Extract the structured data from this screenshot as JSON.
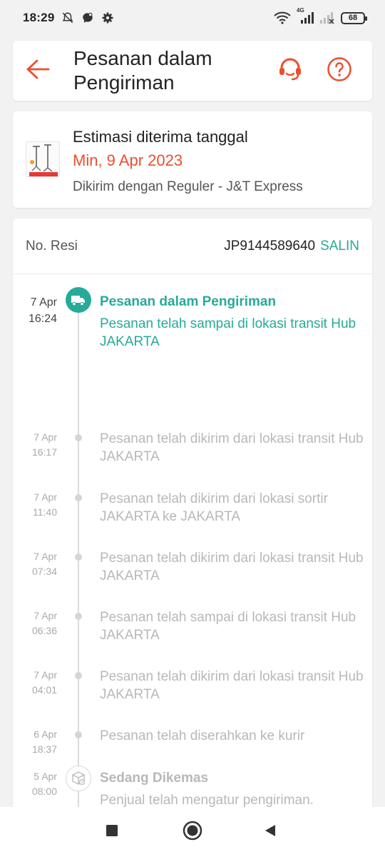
{
  "status_bar": {
    "time": "18:29",
    "battery": "68",
    "network_label": "4G",
    "icons": [
      "bell-off-icon",
      "chat-icon",
      "gear-icon",
      "wifi-icon",
      "signal-icon",
      "signal-x-icon",
      "battery-icon"
    ]
  },
  "header": {
    "title": "Pesanan dalam Pengiriman",
    "icons": [
      "back-arrow-icon",
      "headset-icon",
      "help-icon"
    ]
  },
  "estimate": {
    "label": "Estimasi diterima tanggal",
    "date": "Min, 9 Apr 2023",
    "courier": "Dikirim dengan Reguler - J&T Express"
  },
  "tracking": {
    "resi_label": "No. Resi",
    "resi_number": "JP9144589640",
    "copy_label": "SALIN",
    "events": [
      {
        "date": "7 Apr",
        "time": "16:24",
        "title": "Pesanan dalam Pengiriman",
        "desc": "Pesanan telah sampai di lokasi transit Hub JAKARTA",
        "status": "active"
      },
      {
        "date": "7 Apr",
        "time": "16:17",
        "title": "",
        "desc": "Pesanan telah dikirim dari lokasi transit Hub JAKARTA",
        "status": "past"
      },
      {
        "date": "7 Apr",
        "time": "11:40",
        "title": "",
        "desc": "Pesanan telah dikirim dari lokasi sortir JAKARTA ke JAKARTA",
        "status": "past"
      },
      {
        "date": "7 Apr",
        "time": "07:34",
        "title": "",
        "desc": "Pesanan telah dikirim dari lokasi transit Hub JAKARTA",
        "status": "past"
      },
      {
        "date": "7 Apr",
        "time": "06:36",
        "title": "",
        "desc": "Pesanan telah sampai di lokasi transit Hub JAKARTA",
        "status": "past"
      },
      {
        "date": "7 Apr",
        "time": "04:01",
        "title": "",
        "desc": "Pesanan telah dikirim dari lokasi transit Hub JAKARTA",
        "status": "past"
      },
      {
        "date": "6 Apr",
        "time": "18:37",
        "title": "",
        "desc": "Pesanan telah diserahkan ke kurir",
        "status": "past"
      },
      {
        "date": "5 Apr",
        "time": "08:00",
        "title": "Sedang Dikemas",
        "desc": "Penjual telah mengatur pengiriman. Menunggu pesanan diserahkan ke pihak jasa kirim",
        "status": "packing"
      }
    ]
  },
  "colors": {
    "accent": "#ee4d2d",
    "teal": "#26aa99",
    "muted": "#b8b8b8"
  },
  "navbar": {
    "icons": [
      "recents-square-icon",
      "home-circle-icon",
      "back-triangle-icon"
    ]
  }
}
